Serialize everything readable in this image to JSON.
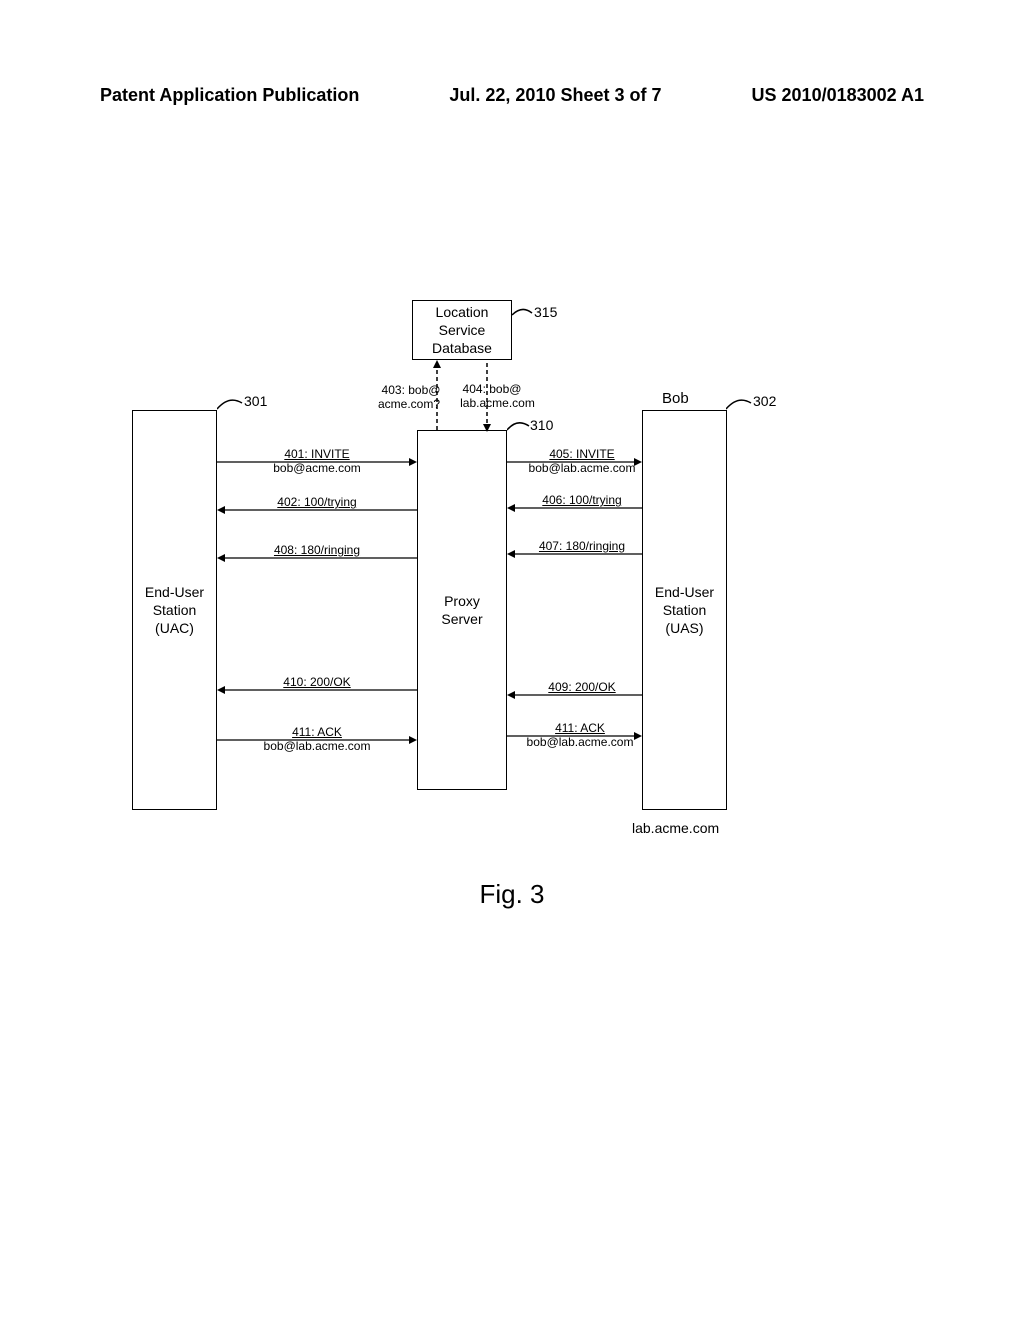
{
  "header": {
    "left": "Patent Application Publication",
    "center": "Jul. 22, 2010  Sheet 3 of 7",
    "right": "US 2010/0183002 A1"
  },
  "boxes": {
    "locdb": "Location\nService\nDatabase",
    "uac": "End-User\nStation\n(UAC)",
    "proxy": "Proxy\nServer",
    "uas": "End-User\nStation\n(UAS)"
  },
  "refs": {
    "r301": "301",
    "r302": "302",
    "r310": "310",
    "r315": "315"
  },
  "labels": {
    "bob": "Bob",
    "domain": "lab.acme.com",
    "q403a": "403: bob@",
    "q403b": "acme.com?",
    "q404a": "404: bob@",
    "q404b": "lab.acme.com"
  },
  "messages": {
    "m401a": "401: INVITE",
    "m401b": "bob@acme.com",
    "m402": "402: 100/trying",
    "m408": "408: 180/ringing",
    "m410": "410: 200/OK",
    "m411a": "411: ACK",
    "m411b": "bob@lab.acme.com",
    "m405a": "405: INVITE",
    "m405b": "bob@lab.acme.com",
    "m406": "406: 100/trying",
    "m407": "407: 180/ringing",
    "m409": "409: 200/OK",
    "m411ra": "411: ACK",
    "m411rb": "bob@lab.acme.com"
  },
  "figure": "Fig. 3"
}
